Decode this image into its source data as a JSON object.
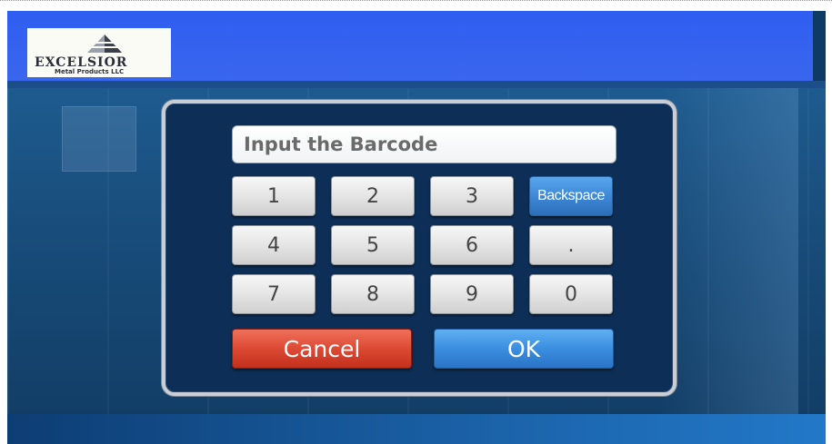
{
  "header": {
    "logo": {
      "name": "EXCELSIOR",
      "subtitle": "Metal Products LLC",
      "icon": "excelsior-logo-mark"
    }
  },
  "dialog": {
    "input": {
      "placeholder": "Input the Barcode",
      "value": ""
    },
    "keypad": {
      "keys": [
        "1",
        "2",
        "3",
        "Backspace",
        "4",
        "5",
        "6",
        ".",
        "7",
        "8",
        "9",
        "0"
      ]
    },
    "cancel_label": "Cancel",
    "ok_label": "OK"
  },
  "colors": {
    "header_blue": "#3a66ee",
    "backspace_blue": "#3b86d4",
    "cancel_red": "#dd4a34",
    "ok_blue": "#3b8ee0",
    "dialog_bg": "#0d2f57"
  }
}
